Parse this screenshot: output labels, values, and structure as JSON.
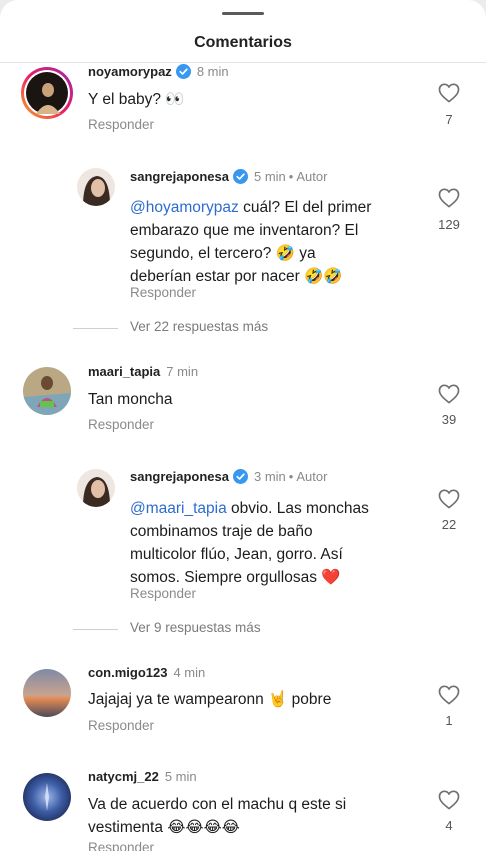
{
  "sheet": {
    "title": "Comentarios"
  },
  "comments": [
    {
      "username": "noyamorypaz",
      "verified": true,
      "time": "8 min",
      "text": "Y el baby? 👀",
      "reply_label": "Responder",
      "likes": "7"
    },
    {
      "username": "sangrejaponesa",
      "verified": true,
      "time": "5 min",
      "author_label": "Autor",
      "mention": "@hoyamorypaz",
      "text_lines": [
        " cuál? El del primer",
        "embarazo que me inventaron? El",
        "segundo, el tercero? 🤣 ya",
        "deberían estar por nacer 🤣🤣"
      ],
      "reply_label": "Responder",
      "likes": "129"
    },
    {
      "username": "maari_tapia",
      "verified": false,
      "time": "7 min",
      "text": "Tan moncha",
      "reply_label": "Responder",
      "likes": "39"
    },
    {
      "username": "sangrejaponesa",
      "verified": true,
      "time": "3 min",
      "author_label": "Autor",
      "mention": "@maari_tapia",
      "text_lines": [
        " obvio. Las monchas",
        "combinamos traje de baño",
        "multicolor flúo, Jean, gorro. Así",
        "somos. Siempre orgullosas ❤️"
      ],
      "reply_label": "Responder",
      "likes": "22"
    },
    {
      "username": "con.migo123",
      "verified": false,
      "time": "4 min",
      "text": "Jajajaj ya te wampearonn 🤘 pobre",
      "reply_label": "Responder",
      "likes": "1"
    },
    {
      "username": "natycmj_22",
      "verified": false,
      "time": "5 min",
      "text_lines": [
        "Va de acuerdo con el machu q este si",
        "vestimenta 😂😂😂😂"
      ],
      "reply_label": "Responder",
      "likes": "4"
    }
  ],
  "view_more": [
    {
      "label": "Ver 22 respuestas más"
    },
    {
      "label": "Ver 9 respuestas más"
    }
  ],
  "colors": {
    "mention": "#2d6ccf",
    "verified": "#3897f0",
    "muted": "#8a8a8a"
  },
  "icons": {
    "like": "heart-outline-icon",
    "verified": "verified-badge-icon"
  }
}
